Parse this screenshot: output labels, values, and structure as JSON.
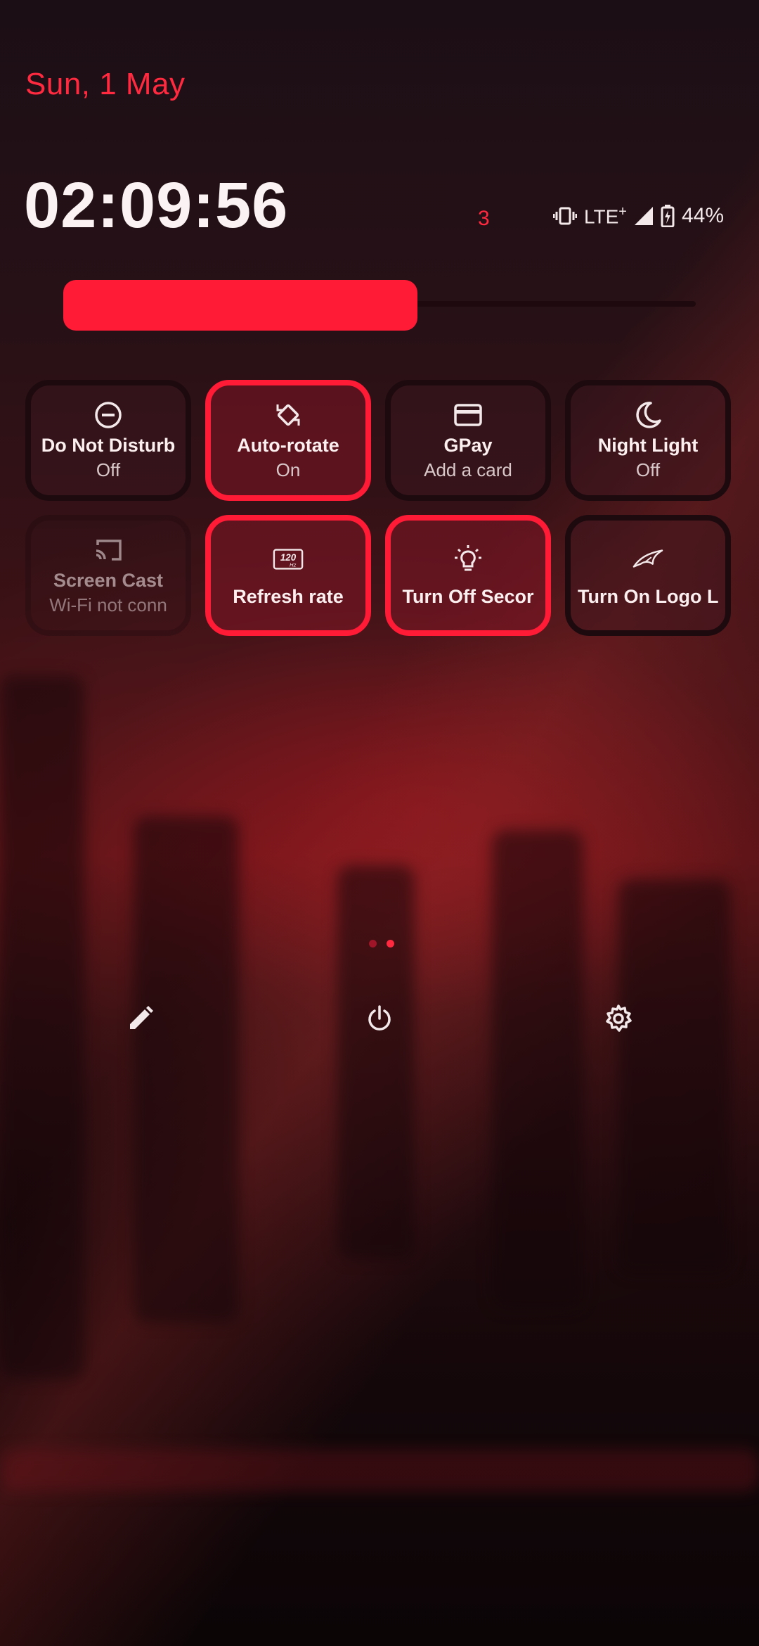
{
  "header": {
    "date": "Sun, 1 May",
    "time": "02:09:56",
    "notification_count": "3"
  },
  "status": {
    "network": "LTE",
    "network_suffix": "+",
    "battery": "44%"
  },
  "brightness": {
    "level": 0.56
  },
  "tiles": [
    {
      "label": "Do Not Disturb",
      "sub": "Off",
      "icon": "do-not-disturb-icon",
      "state": "off"
    },
    {
      "label": "Auto-rotate",
      "sub": "On",
      "icon": "auto-rotate-icon",
      "state": "on"
    },
    {
      "label": "GPay",
      "sub": "Add a card",
      "icon": "card-icon",
      "state": "off"
    },
    {
      "label": "Night Light",
      "sub": "Off",
      "icon": "moon-icon",
      "state": "off"
    },
    {
      "label": "Screen Cast",
      "sub": "Wi-Fi not conn",
      "icon": "cast-icon",
      "state": "disabled"
    },
    {
      "label": "Refresh rate",
      "sub": "",
      "icon": "refresh-rate-120hz-icon",
      "icon_text": "120",
      "icon_subtext": "Hz",
      "state": "on"
    },
    {
      "label": "Turn Off Secor",
      "sub": "",
      "icon": "lightbulb-icon",
      "state": "on"
    },
    {
      "label": "Turn On Logo L",
      "sub": "",
      "icon": "rog-logo-icon",
      "state": "off"
    }
  ],
  "pager": {
    "pages": 2,
    "current": 2
  },
  "footer": {
    "icons": [
      "edit-icon",
      "power-icon",
      "settings-icon"
    ]
  },
  "colors": {
    "accent": "#ff1a36",
    "date": "#ff2a3f"
  }
}
